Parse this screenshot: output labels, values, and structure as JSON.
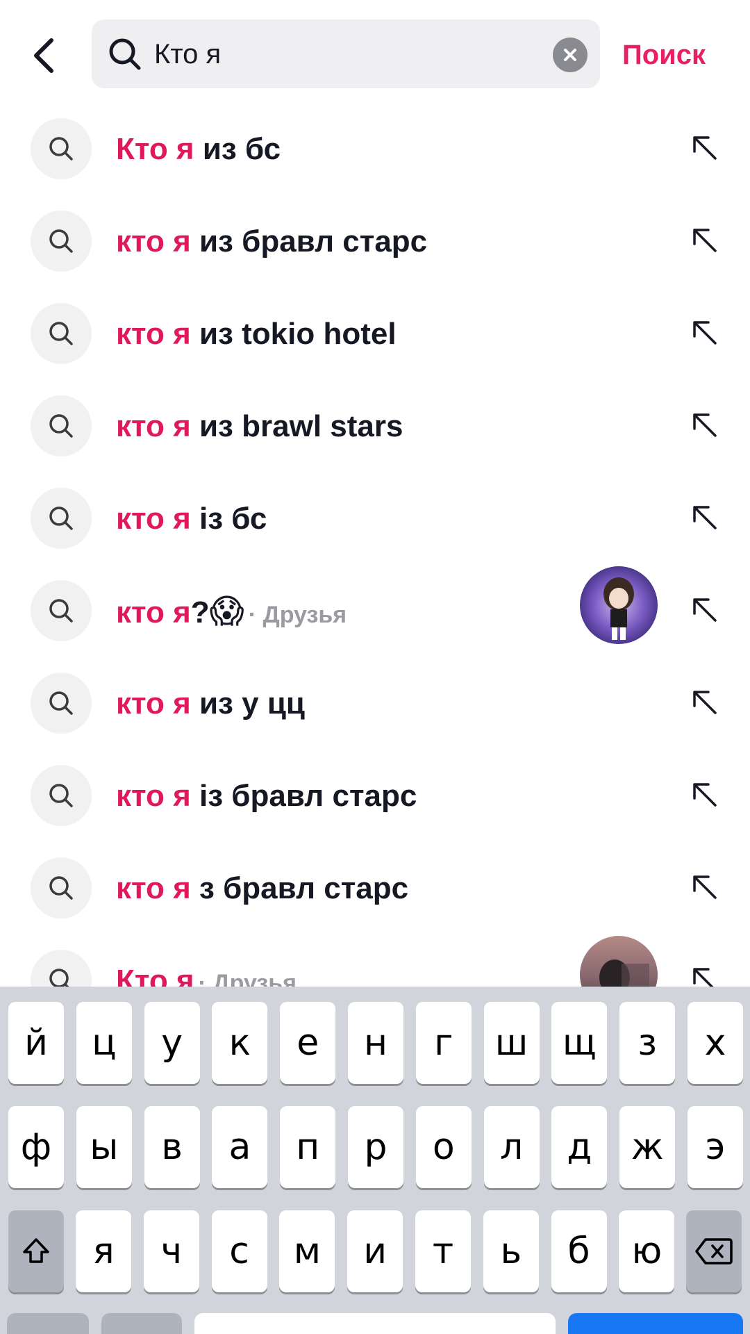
{
  "header": {
    "search_value": "Кто я",
    "submit_label": "Поиск"
  },
  "suggestions": [
    {
      "highlight": "Кто я",
      "rest": " из бс",
      "meta": "",
      "has_emoji": false,
      "has_thumb": false
    },
    {
      "highlight": "кто я",
      "rest": " из бравл старс",
      "meta": "",
      "has_emoji": false,
      "has_thumb": false
    },
    {
      "highlight": "кто я",
      "rest": " из tokio hotel",
      "meta": "",
      "has_emoji": false,
      "has_thumb": false
    },
    {
      "highlight": "кто я",
      "rest": " из brawl stars",
      "meta": "",
      "has_emoji": false,
      "has_thumb": false
    },
    {
      "highlight": "кто я",
      "rest": " із бс",
      "meta": "",
      "has_emoji": false,
      "has_thumb": false
    },
    {
      "highlight": "кто я",
      "rest": "?",
      "emoji": "😱",
      "meta": "· Друзья",
      "has_emoji": true,
      "has_thumb": true
    },
    {
      "highlight": "кто я",
      "rest": " из у цц",
      "meta": "",
      "has_emoji": false,
      "has_thumb": false
    },
    {
      "highlight": "кто я",
      "rest": " із бравл старс",
      "meta": "",
      "has_emoji": false,
      "has_thumb": false
    },
    {
      "highlight": "кто я",
      "rest": " з бравл старс",
      "meta": "",
      "has_emoji": false,
      "has_thumb": false
    },
    {
      "highlight": "Кто я",
      "rest": "",
      "meta": "· Друзья",
      "has_emoji": false,
      "has_thumb": true
    }
  ],
  "keyboard": {
    "row1": [
      "й",
      "ц",
      "у",
      "к",
      "е",
      "н",
      "г",
      "ш",
      "щ",
      "з",
      "х"
    ],
    "row2": [
      "ф",
      "ы",
      "в",
      "а",
      "п",
      "р",
      "о",
      "л",
      "д",
      "ж",
      "э"
    ],
    "row3": [
      "я",
      "ч",
      "с",
      "м",
      "и",
      "т",
      "ь",
      "б",
      "ю"
    ]
  },
  "colors": {
    "accent": "#e91e63",
    "highlight": "#e0195c",
    "keyboard_bg": "#d1d4db",
    "search_bg": "#efeff1"
  }
}
